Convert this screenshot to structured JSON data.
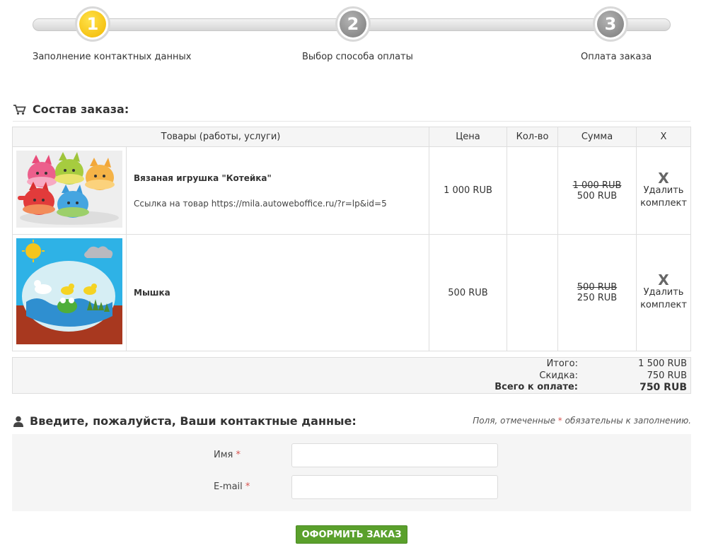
{
  "steps": [
    {
      "number": "1",
      "label": "Заполнение контактных данных",
      "state": "active"
    },
    {
      "number": "2",
      "label": "Выбор способа оплаты",
      "state": "idle"
    },
    {
      "number": "3",
      "label": "Оплата заказа",
      "state": "idle"
    }
  ],
  "order": {
    "title": "Состав заказа:",
    "icon": "cart-icon",
    "columns": {
      "product": "Товары (работы, услуги)",
      "price": "Цена",
      "qty": "Кол-во",
      "sum": "Сумма",
      "delete": "X"
    },
    "items": [
      {
        "name": "Вязаная игрушка \"Котейка\"",
        "link_text": "Ссылка на товар https://mila.autoweboffice.ru/?r=lp&id=5",
        "price": "1 000 RUB",
        "qty": "",
        "sum_old": "1 000 RUB",
        "sum_new": "500 RUB",
        "delete_icon": "X",
        "delete_label": "Удалить комплект"
      },
      {
        "name": "Мышка",
        "link_text": "",
        "price": "500 RUB",
        "qty": "",
        "sum_old": "500 RUB",
        "sum_new": "250 RUB",
        "delete_icon": "X",
        "delete_label": "Удалить комплект"
      }
    ],
    "totals": {
      "subtotal_label": "Итого:",
      "subtotal_value": "1 500 RUB",
      "discount_label": "Скидка:",
      "discount_value": "750 RUB",
      "total_label": "Всего к оплате:",
      "total_value": "750 RUB"
    }
  },
  "contact": {
    "title": "Введите, пожалуйста, Ваши контактные данные:",
    "icon": "user-icon",
    "required_note_before": "Поля, отмеченные",
    "required_star": "*",
    "required_note_after": "обязательны к заполнению.",
    "fields": [
      {
        "label": "Имя",
        "value": "",
        "placeholder": ""
      },
      {
        "label": "E-mail",
        "value": "",
        "placeholder": ""
      }
    ]
  },
  "submit_label": "ОФОРМИТЬ ЗАКАЗ",
  "colors": {
    "step_active": "#f2b700",
    "step_idle": "#8a8a8a",
    "submit": "#5aa02c",
    "required_star": "#d9534f"
  }
}
